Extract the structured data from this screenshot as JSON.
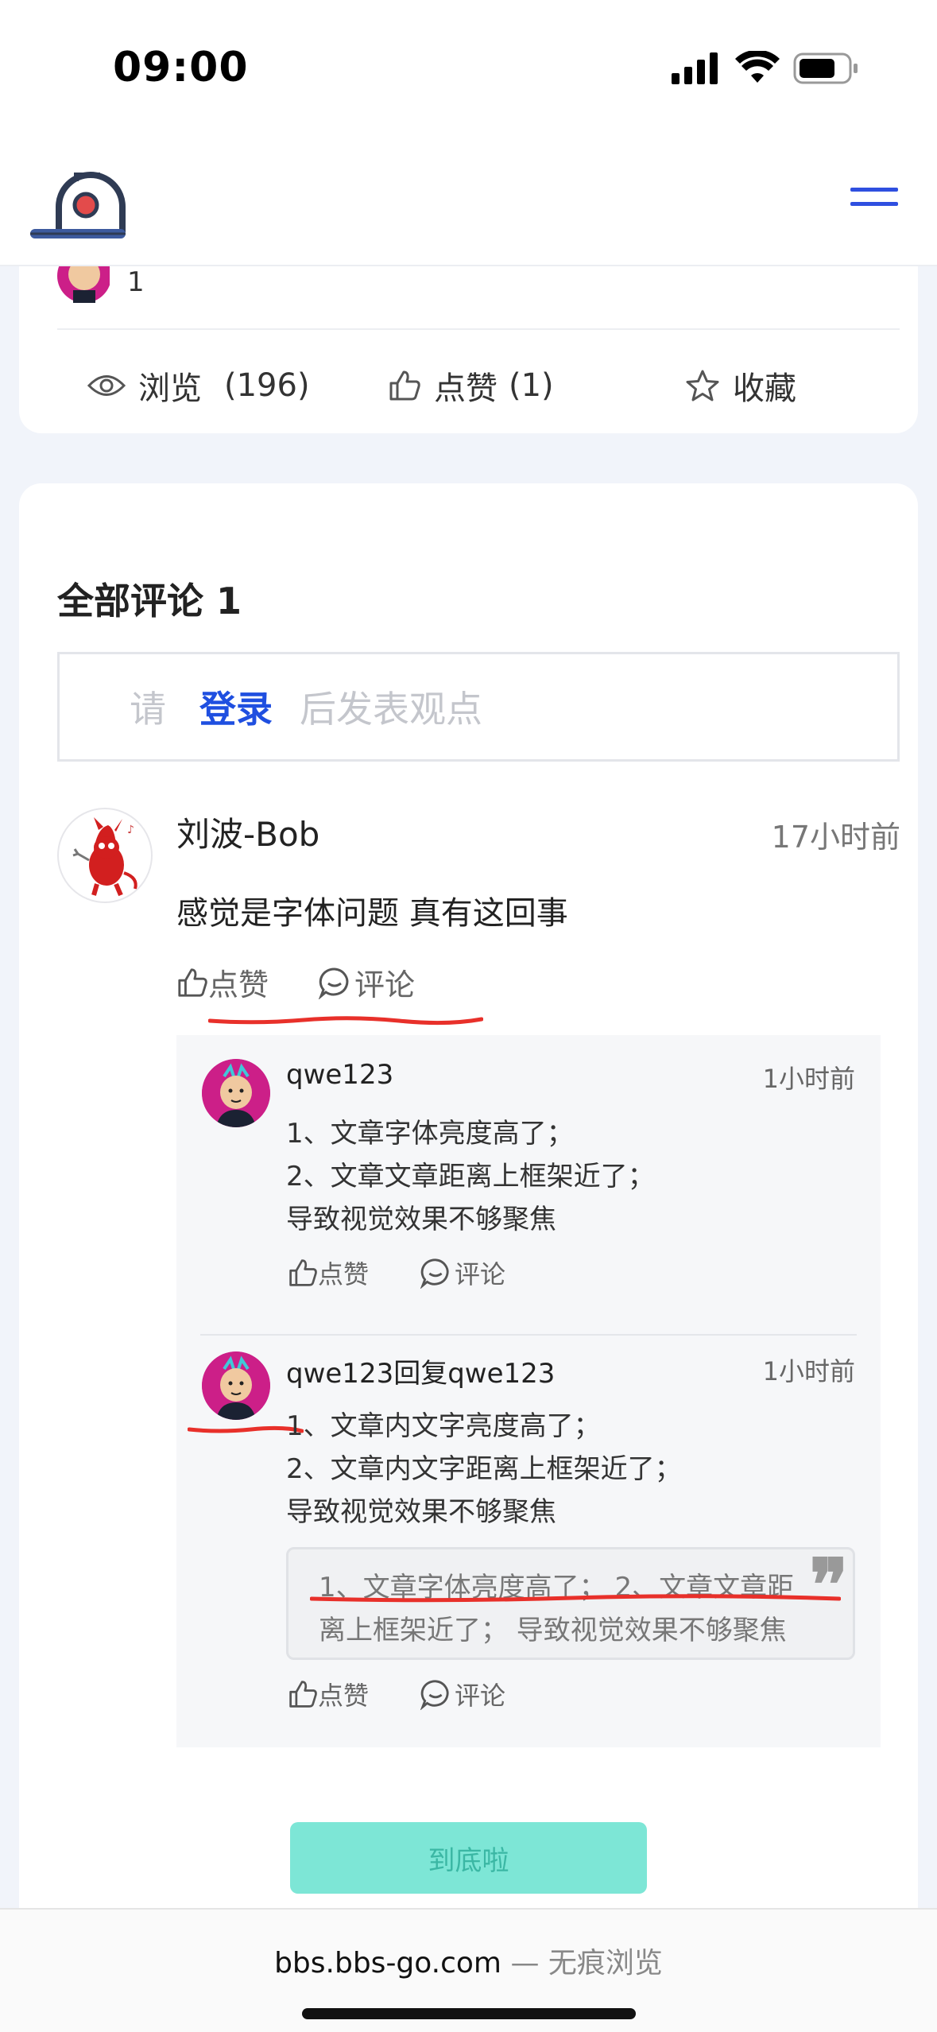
{
  "status": {
    "time": "09:00"
  },
  "post_stats": {
    "author_count": "1",
    "views_label": "浏览",
    "views_count": "(196)",
    "likes_label": "点赞",
    "likes_count": "(1)",
    "favorite_label": "收藏"
  },
  "comments": {
    "title": "全部评论 1",
    "login_prompt": {
      "pre": "请",
      "link": "登录",
      "post": "后发表观点"
    },
    "items": [
      {
        "author": "刘波-Bob",
        "time": "17小时前",
        "text": "感觉是字体问题 真有这回事",
        "like_label": "点赞",
        "reply_label": "评论",
        "replies": [
          {
            "author": "qwe123",
            "time": "1小时前",
            "lines": [
              "1、文章字体亮度高了；",
              "2、文章文章距离上框架近了；",
              "导致视觉效果不够聚焦"
            ],
            "like_label": "点赞",
            "reply_label": "评论"
          },
          {
            "author": "qwe123回复qwe123",
            "time": "1小时前",
            "lines": [
              "1、文章内文字亮度高了；",
              "2、文章内文字距离上框架近了；",
              "导致视觉效果不够聚焦"
            ],
            "quote_lines": [
              "1、文章字体亮度高了； 2、文章文章距",
              "离上框架近了； 导致视觉效果不够聚焦"
            ],
            "like_label": "点赞",
            "reply_label": "评论"
          }
        ]
      }
    ]
  },
  "end_button": "到底啦",
  "browser": {
    "url": "bbs.bbs-go.com",
    "suffix": " — 无痕浏览"
  },
  "colors": {
    "accent": "#1f4fe0",
    "end_button": "#7de6d6",
    "annotation": "#e8302a"
  }
}
